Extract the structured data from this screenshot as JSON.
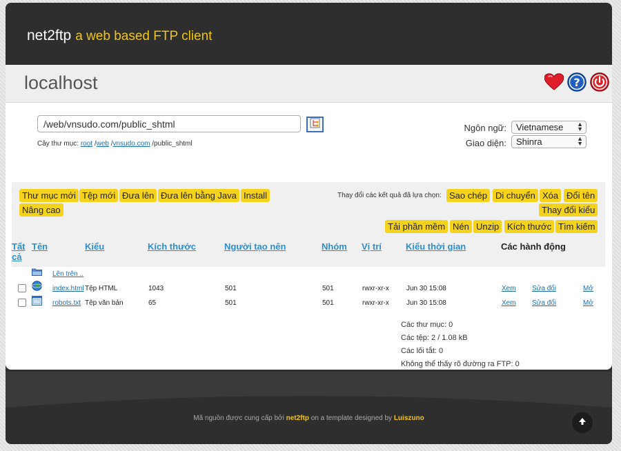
{
  "app": {
    "name": "net2ftp",
    "tagline": "a web based FTP client"
  },
  "host": "localhost",
  "title_icons": [
    "heart-icon",
    "help-icon",
    "power-icon"
  ],
  "directory": {
    "value": "/web/vnsudo.com/public_shtml",
    "tree_label": "Cây thư mục:",
    "tree": [
      "root",
      "web",
      "vnsudo.com"
    ],
    "tree_last": "public_shtml"
  },
  "language": {
    "label": "Ngôn ngữ:",
    "value": "Vietnamese"
  },
  "skin": {
    "label": "Giao diện:",
    "value": "Shinra"
  },
  "toolbar": {
    "new_dir": "Thư mục mới",
    "new_file": "Tệp mới",
    "upload": "Đưa lên",
    "java_upload": "Đưa lên bằng Java",
    "install": "Install",
    "advanced": "Nâng cao",
    "selection_note": "Thay đổi các kết quả đã lựa chọn:",
    "copy": "Sao chép",
    "move": "Di chuyển",
    "delete": "Xóa",
    "rename": "Đổi tên",
    "chmod": "Thay đổi kiểu",
    "download": "Tải phần mềm",
    "zip": "Nén",
    "unzip": "Unzip",
    "size": "Kích thước",
    "search": "Tìm kiếm"
  },
  "columns": {
    "all_line1": "Tất",
    "all_line2": "cả",
    "name": "Tên",
    "type": "Kiểu",
    "size": "Kích thước",
    "owner": "Người tạo nên",
    "group": "Nhóm",
    "perms": "Vị trí",
    "mtime": "Kiểu thời gian",
    "actions": "Các hành động"
  },
  "up_label": "Lên trên ..",
  "files": [
    {
      "name": "index.html",
      "type": "Tệp HTML",
      "size": "1043",
      "owner": "501",
      "group": "501",
      "perms": "rwxr-xr-x",
      "mtime": "Jun 30 15:08",
      "view": "Xem",
      "edit": "Sửa đổi",
      "open": "Mở",
      "icon": "globe-icon"
    },
    {
      "name": "robots.txt",
      "type": "Tệp văn bản",
      "size": "65",
      "owner": "501",
      "group": "501",
      "perms": "rwxr-xr-x",
      "mtime": "Jun 30 15:08",
      "view": "Xem",
      "edit": "Sửa đổi",
      "open": "Mở",
      "icon": "window-icon"
    }
  ],
  "stats": {
    "dirs": "Các thư mục: 0",
    "files": "Các tệp: 2 / 1.08 kB",
    "links": "Các lối tắt: 0",
    "errors": "Không thể thấy rõ đường ra FTP: 0"
  },
  "footer": {
    "prefix": "Mã nguồn được cung cấp bởi",
    "brand": "net2ftp",
    "middle": "on a template designed by",
    "author": "Luiszuno"
  },
  "colors": {
    "accent": "#f5d21c",
    "link": "#2a8fd0",
    "dark": "#2e2e2e"
  }
}
